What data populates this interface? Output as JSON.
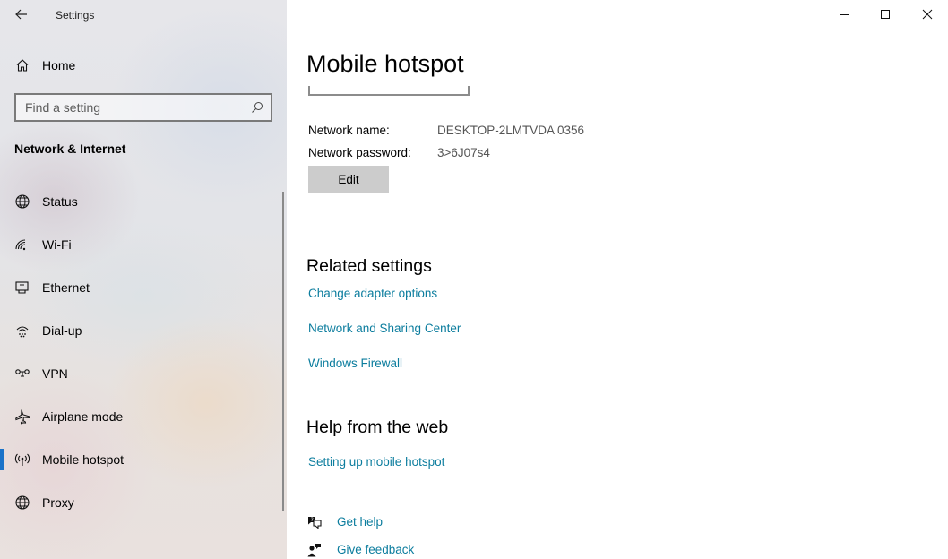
{
  "app": {
    "title": "Settings"
  },
  "sidebar": {
    "home_label": "Home",
    "search_placeholder": "Find a setting",
    "section_heading": "Network & Internet",
    "items": [
      {
        "label": "Status",
        "icon": "globe-status-icon",
        "selected": false
      },
      {
        "label": "Wi-Fi",
        "icon": "wifi-icon",
        "selected": false
      },
      {
        "label": "Ethernet",
        "icon": "ethernet-icon",
        "selected": false
      },
      {
        "label": "Dial-up",
        "icon": "dialup-icon",
        "selected": false
      },
      {
        "label": "VPN",
        "icon": "vpn-icon",
        "selected": false
      },
      {
        "label": "Airplane mode",
        "icon": "airplane-icon",
        "selected": false
      },
      {
        "label": "Mobile hotspot",
        "icon": "hotspot-icon",
        "selected": true
      },
      {
        "label": "Proxy",
        "icon": "globe-proxy-icon",
        "selected": false
      }
    ]
  },
  "main": {
    "title": "Mobile hotspot",
    "network": {
      "name_label": "Network name:",
      "name_value": "DESKTOP-2LMTVDA 0356",
      "password_label": "Network password:",
      "password_value": "3>6J07s4",
      "edit_label": "Edit"
    },
    "related": {
      "heading": "Related settings",
      "links": [
        "Change adapter options",
        "Network and Sharing Center",
        "Windows Firewall"
      ]
    },
    "help": {
      "heading": "Help from the web",
      "link": "Setting up mobile hotspot"
    },
    "support": {
      "get_help": "Get help",
      "give_feedback": "Give feedback"
    }
  },
  "colors": {
    "accent": "#1a73c9",
    "link": "#0c7d9e",
    "button_bg": "#cccccc"
  }
}
